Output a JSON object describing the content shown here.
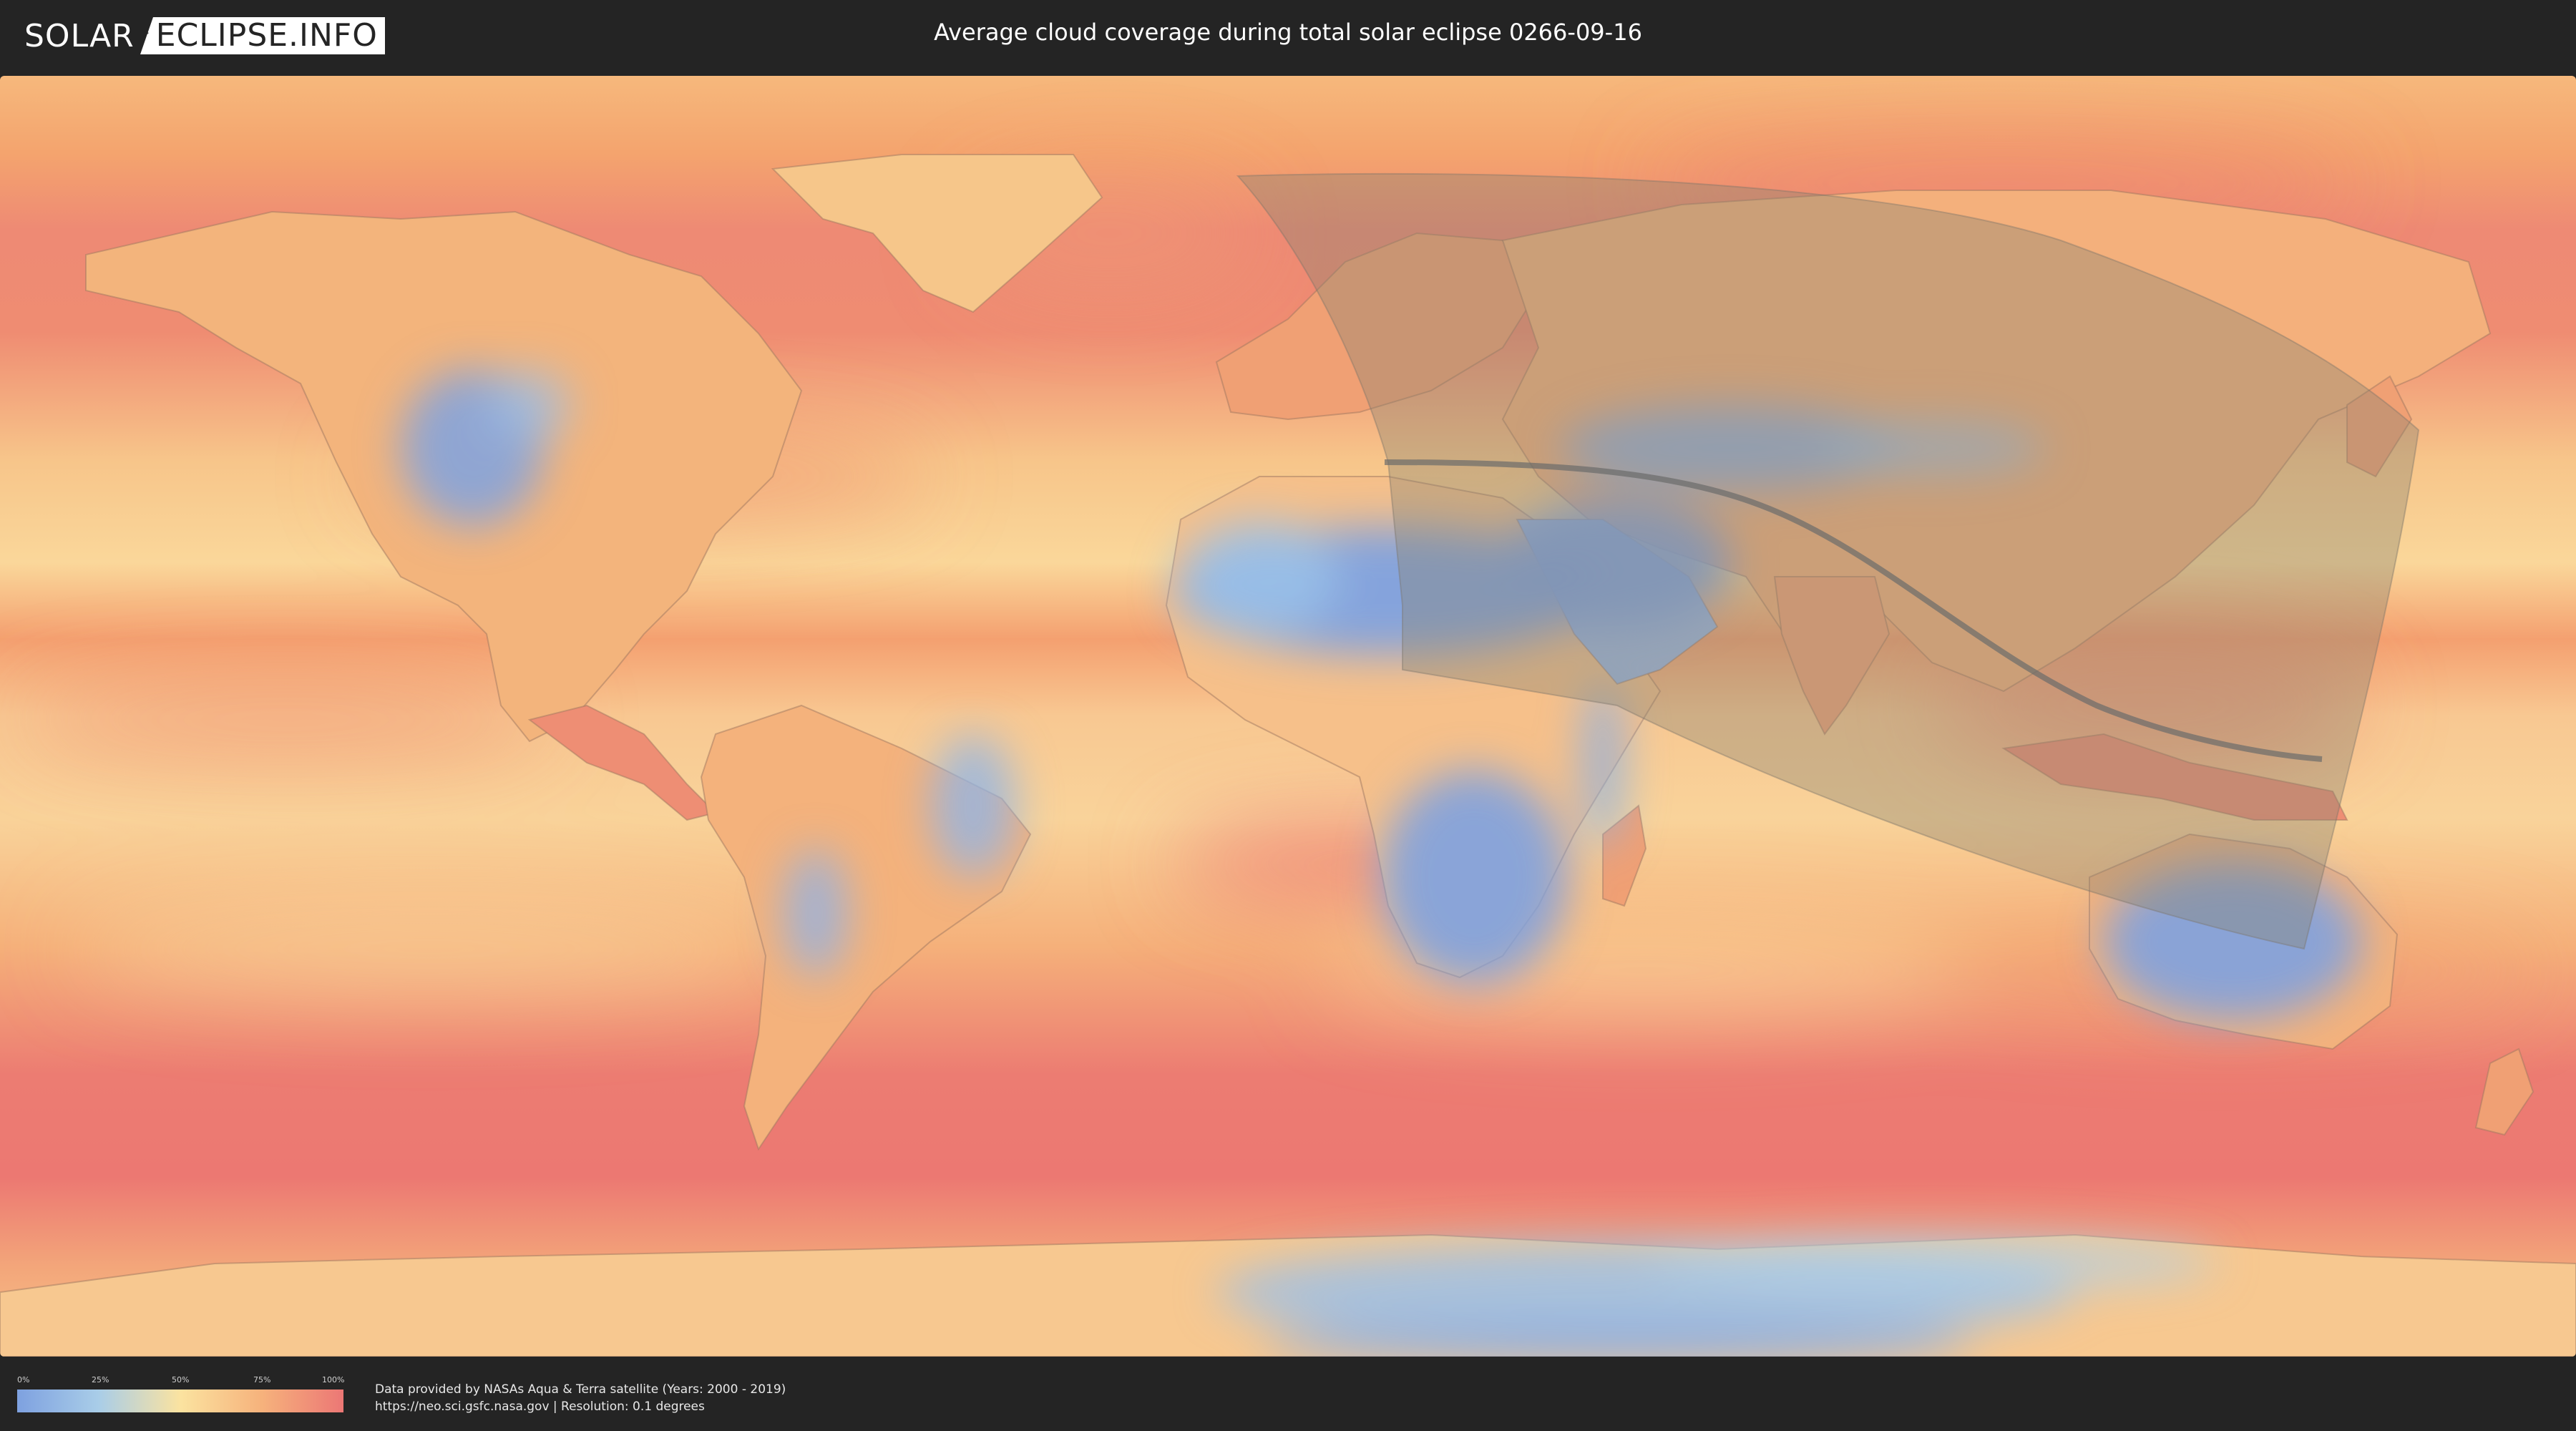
{
  "header": {
    "logo_left": "SOLAR",
    "logo_right": "ECLIPSE.INFO",
    "title": "Average cloud coverage during total solar eclipse 0266-09-16"
  },
  "legend": {
    "ticks": [
      "0%",
      "25%",
      "50%",
      "75%",
      "100%"
    ],
    "tick_values": [
      0,
      25,
      50,
      75,
      100
    ],
    "colors": {
      "low": "#7ea1e0",
      "mid_low": "#a9cde8",
      "mid": "#fbe3a0",
      "mid_high": "#f6b27c",
      "high": "#ec7775"
    }
  },
  "credit": {
    "line1": "Data provided by NASAs Aqua & Terra satellite (Years: 2000 - 2019)",
    "line2": "https://neo.sci.gsfc.nasa.gov | Resolution: 0.1 degrees"
  },
  "eclipse": {
    "type": "total",
    "date": "0266-09-16",
    "path_color": "#6b6b6b",
    "visibility_zone_color": "#8a8370"
  }
}
